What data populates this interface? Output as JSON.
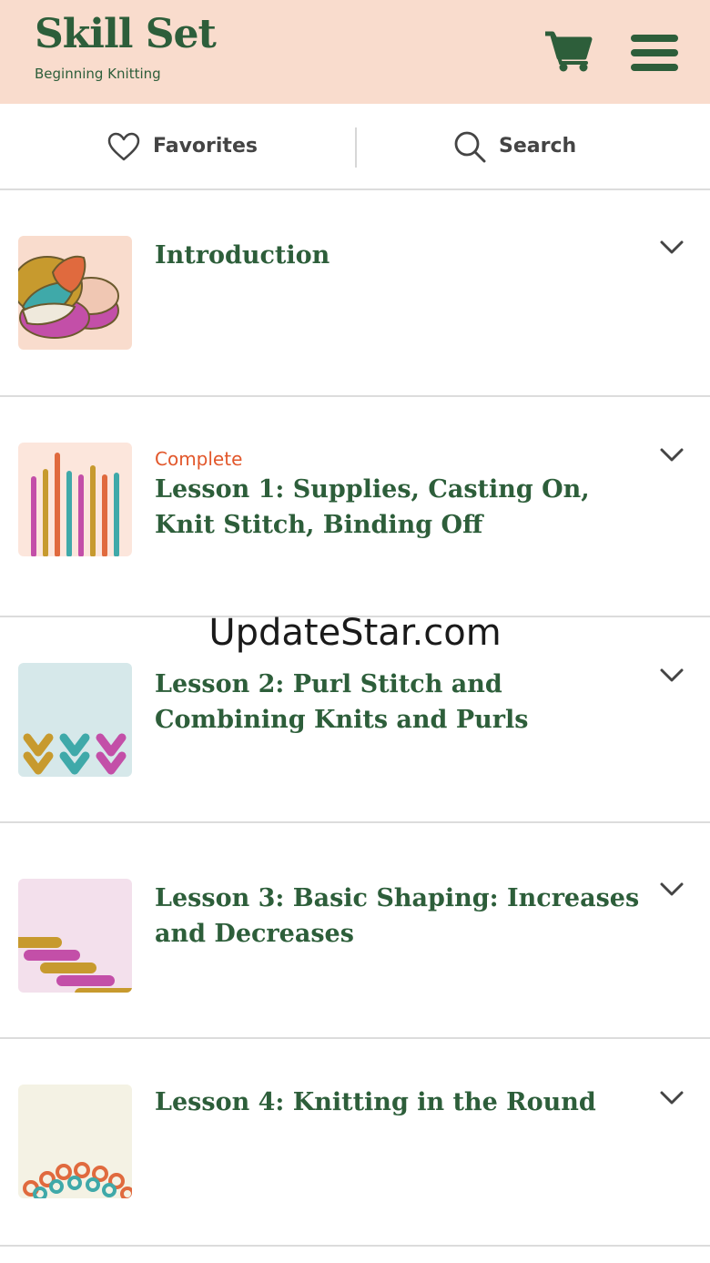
{
  "header": {
    "title": "Skill Set",
    "subtitle": "Beginning Knitting",
    "cart_icon": "cart-icon",
    "menu_icon": "hamburger-menu-icon",
    "background_color": "#f9dccd",
    "brand_color": "#2d5e3a"
  },
  "toolbar": {
    "favorites_label": "Favorites",
    "search_label": "Search"
  },
  "lessons": [
    {
      "status": "",
      "title": "Introduction",
      "thumb_bg": "#f9dccd"
    },
    {
      "status": "Complete",
      "title": "Lesson 1: Supplies, Casting On, Knit Stitch, Binding Off",
      "thumb_bg": "#fce6dc"
    },
    {
      "status": "",
      "title": "Lesson 2: Purl Stitch and Combining Knits and Purls",
      "thumb_bg": "#d6e8ea"
    },
    {
      "status": "",
      "title": "Lesson 3: Basic Shaping: Increases and Decreases",
      "thumb_bg": "#f3e0ec"
    },
    {
      "status": "",
      "title": "Lesson 4: Knitting in the Round",
      "thumb_bg": "#f4f2e4"
    }
  ],
  "status_color": "#e2572b",
  "watermark": "UpdateStar.com"
}
